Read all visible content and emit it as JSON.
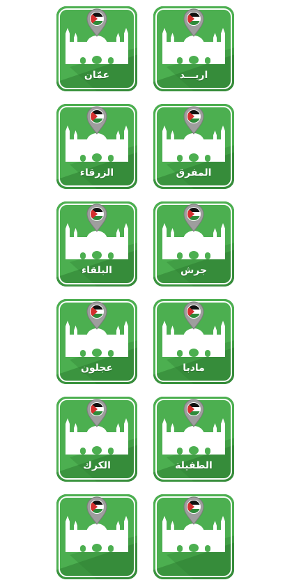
{
  "colors": {
    "tile_green": "#4caf50",
    "tile_dark": "#2e7d32",
    "pin_gray": "#9e9e9e",
    "flag_black": "#111111",
    "flag_green": "#2e8b3a",
    "flag_red": "#d32f2f"
  },
  "icons": {
    "tile_art": "mosque-icon",
    "pin": "location-pin-icon",
    "flag": "jordan-flag-icon"
  },
  "cities": [
    {
      "label": "عمّان"
    },
    {
      "label": "اربـــد"
    },
    {
      "label": "الزرقاء"
    },
    {
      "label": "المفرق"
    },
    {
      "label": "البلقاء"
    },
    {
      "label": "جرش"
    },
    {
      "label": "عجلون"
    },
    {
      "label": "مادبا"
    },
    {
      "label": "الكرك"
    },
    {
      "label": "الطفيلة"
    },
    {
      "label": ""
    },
    {
      "label": ""
    }
  ]
}
